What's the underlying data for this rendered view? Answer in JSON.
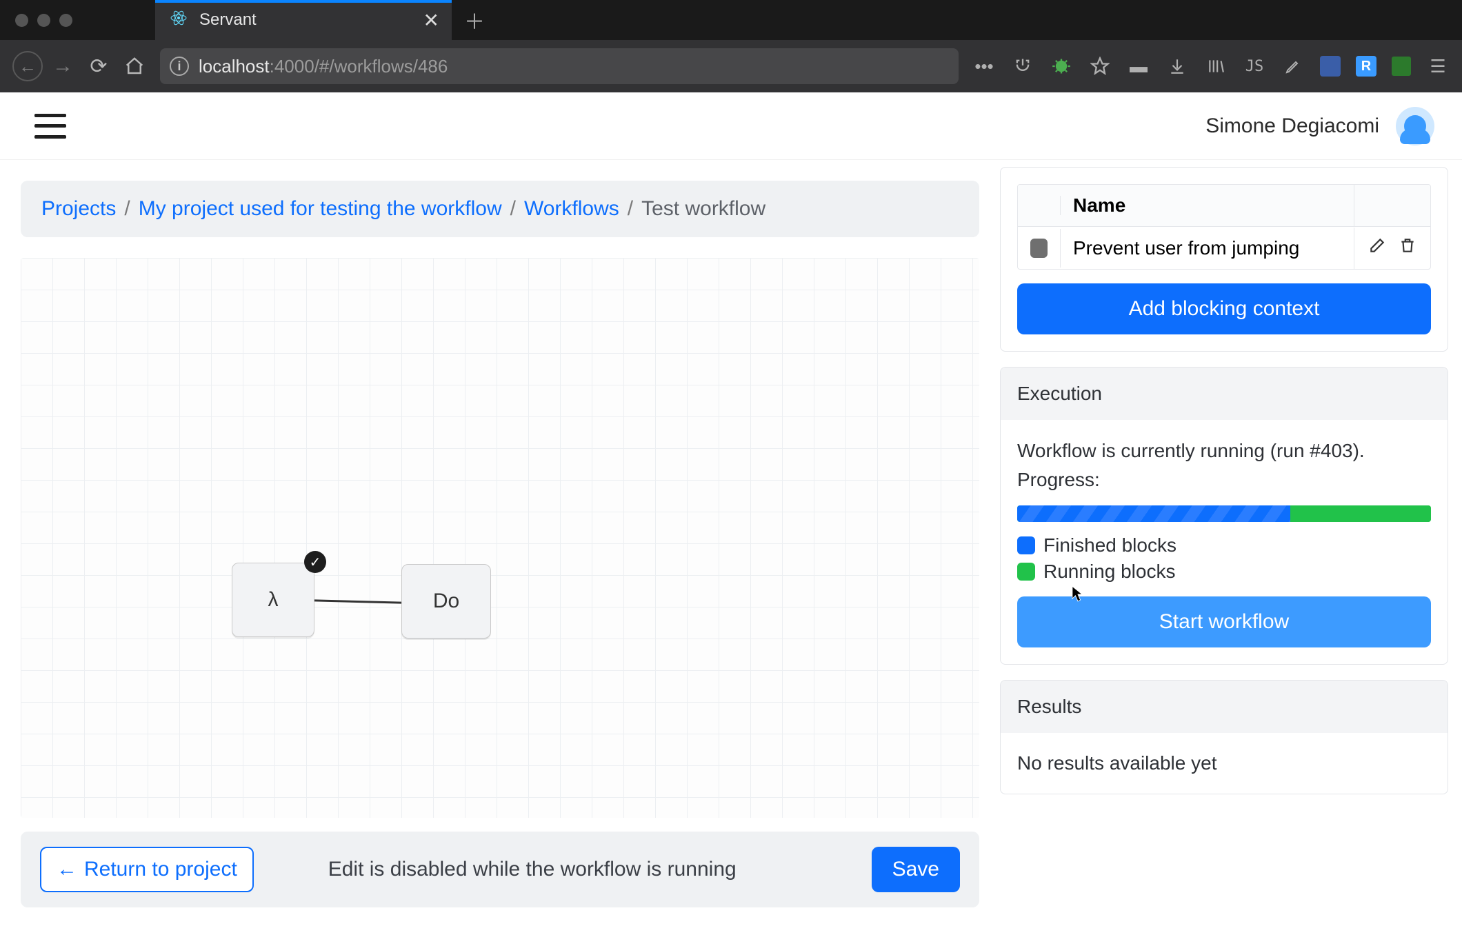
{
  "browser": {
    "tab_title": "Servant",
    "url_host_bold": "localhost",
    "url_host_muted": ":4000/#/workflows/486"
  },
  "header": {
    "user_name": "Simone Degiacomi"
  },
  "breadcrumb": {
    "items": [
      "Projects",
      "My project used for testing the workflow",
      "Workflows"
    ],
    "current": "Test workflow"
  },
  "canvas": {
    "node_a": "λ",
    "node_b": "Do"
  },
  "bottom_bar": {
    "return_label": "Return to project",
    "edit_msg": "Edit is disabled while the workflow is running",
    "save_label": "Save"
  },
  "contexts_panel": {
    "name_header": "Name",
    "rows": [
      {
        "name": "Prevent user from jumping"
      }
    ],
    "add_button": "Add blocking context"
  },
  "execution_panel": {
    "title": "Execution",
    "status_line": "Workflow is currently running (run #403). Progress:",
    "progress_finished_pct": 66,
    "progress_running_pct": 34,
    "legend_finished": "Finished blocks",
    "legend_running": "Running blocks",
    "start_button": "Start workflow"
  },
  "results_panel": {
    "title": "Results",
    "body": "No results available yet"
  }
}
